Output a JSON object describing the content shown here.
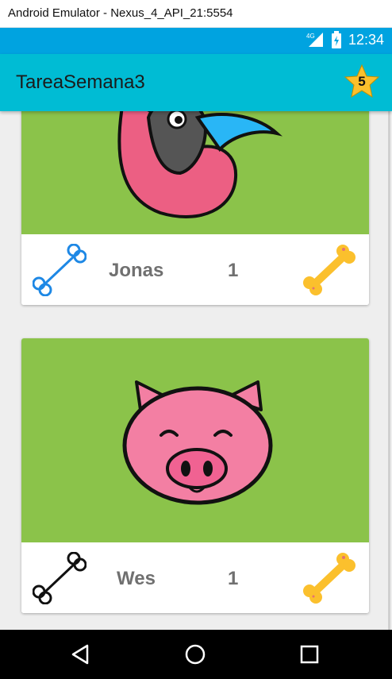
{
  "window": {
    "title": "Android Emulator - Nexus_4_API_21:5554"
  },
  "status_bar": {
    "time": "12:34",
    "network_label": "4G"
  },
  "app_bar": {
    "title": "TareaSemana3",
    "rating_count": "5"
  },
  "pets": [
    {
      "name": "Jonas",
      "likes": "1",
      "animal": "bird",
      "bone_color": "#1e88e5"
    },
    {
      "name": "Wes",
      "likes": "1",
      "animal": "pig",
      "bone_color": "#111111"
    }
  ],
  "colors": {
    "status_bar": "#00a3e0",
    "app_bar": "#00bcd4",
    "card_image_bg": "#8bc34a",
    "gold_bone": "#fbc02d",
    "star": "#fbc02d"
  },
  "nav": {
    "back": "back-icon",
    "home": "home-icon",
    "recents": "recents-icon"
  }
}
